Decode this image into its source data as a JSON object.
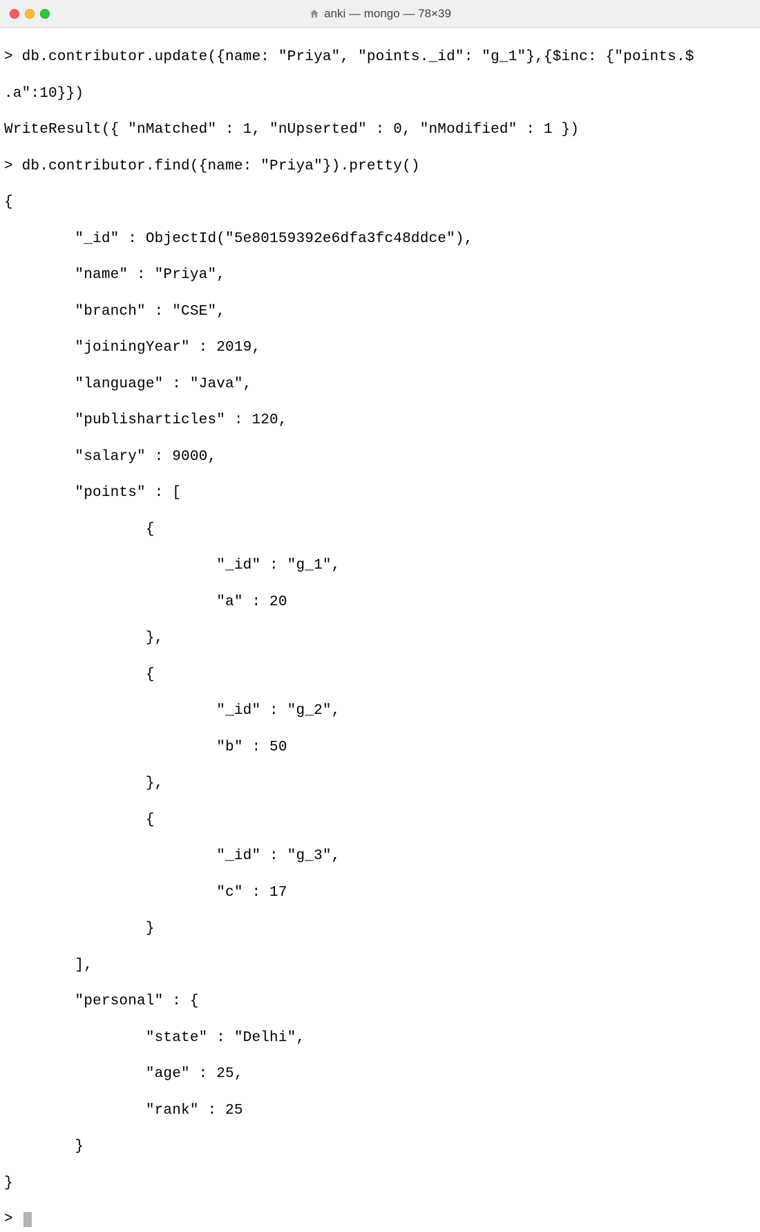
{
  "window": {
    "title": "anki — mongo — 78×39"
  },
  "terminal": {
    "line1": "> db.contributor.update({name: \"Priya\", \"points._id\": \"g_1\"},{$inc: {\"points.$",
    "line2": ".a\":10}})",
    "line3": "WriteResult({ \"nMatched\" : 1, \"nUpserted\" : 0, \"nModified\" : 1 })",
    "line4": "> db.contributor.find({name: \"Priya\"}).pretty()",
    "line5": "{",
    "line6": "        \"_id\" : ObjectId(\"5e80159392e6dfa3fc48ddce\"),",
    "line7": "        \"name\" : \"Priya\",",
    "line8": "        \"branch\" : \"CSE\",",
    "line9": "        \"joiningYear\" : 2019,",
    "line10": "        \"language\" : \"Java\",",
    "line11": "        \"publisharticles\" : 120,",
    "line12": "        \"salary\" : 9000,",
    "line13": "        \"points\" : [",
    "line14": "                {",
    "line15": "                        \"_id\" : \"g_1\",",
    "line16": "                        \"a\" : 20",
    "line17": "                },",
    "line18": "                {",
    "line19": "                        \"_id\" : \"g_2\",",
    "line20": "                        \"b\" : 50",
    "line21": "                },",
    "line22": "                {",
    "line23": "                        \"_id\" : \"g_3\",",
    "line24": "                        \"c\" : 17",
    "line25": "                }",
    "line26": "        ],",
    "line27": "        \"personal\" : {",
    "line28": "                \"state\" : \"Delhi\",",
    "line29": "                \"age\" : 25,",
    "line30": "                \"rank\" : 25",
    "line31": "        }",
    "line32": "}",
    "line33": "> "
  }
}
